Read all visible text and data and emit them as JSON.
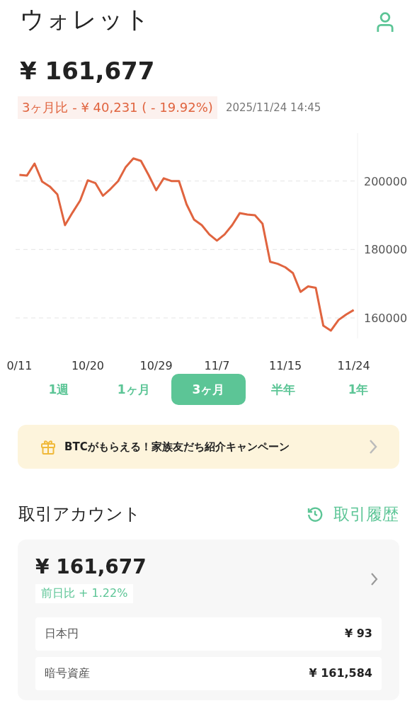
{
  "header": {
    "title": "ウォレット"
  },
  "total": {
    "amount": "¥ 161,677",
    "change": "3ヶ月比 - ¥ 40,231 ( - 19.92%)",
    "timestamp": "2025/11/24 14:45"
  },
  "chart_data": {
    "type": "line",
    "categories": [
      "0/11",
      null,
      null,
      null,
      null,
      null,
      null,
      null,
      null,
      "10/20",
      null,
      null,
      null,
      null,
      null,
      null,
      null,
      null,
      "10/29",
      null,
      null,
      null,
      null,
      null,
      null,
      null,
      "11/7",
      null,
      null,
      null,
      null,
      null,
      null,
      null,
      null,
      "11/15",
      null,
      null,
      null,
      null,
      null,
      null,
      null,
      null,
      "11/24"
    ],
    "series": [
      {
        "color": "#e0643f",
        "values": [
          201800,
          201600,
          205100,
          199800,
          198400,
          196100,
          187100,
          190800,
          194300,
          200200,
          199400,
          195700,
          197700,
          200000,
          204100,
          206600,
          205900,
          201800,
          197300,
          200800,
          200000,
          200000,
          193200,
          188700,
          187100,
          184400,
          182600,
          184400,
          187100,
          190600,
          190200,
          190000,
          187500,
          176400,
          175800,
          174800,
          173100,
          167600,
          169200,
          168800,
          157700,
          156300,
          159400,
          161000,
          162300
        ]
      }
    ],
    "grid": true,
    "ylim": [
      154000,
      214000
    ],
    "yticks": [
      160000,
      180000,
      200000
    ]
  },
  "ranges": [
    {
      "label": "1週",
      "selected": false
    },
    {
      "label": "1ヶ月",
      "selected": false
    },
    {
      "label": "3ヶ月",
      "selected": true
    },
    {
      "label": "半年",
      "selected": false
    },
    {
      "label": "1年",
      "selected": false
    }
  ],
  "banner": {
    "text": "BTCがもらえる！家族友だち紹介キャンペーン"
  },
  "account": {
    "title": "取引アカウント",
    "history_link": "取引履歴",
    "amount": "¥ 161,677",
    "daily_change": "前日比 + 1.22%",
    "rows": [
      {
        "label": "日本円",
        "value": "¥ 93"
      },
      {
        "label": "暗号資産",
        "value": "¥ 161,584"
      }
    ]
  }
}
